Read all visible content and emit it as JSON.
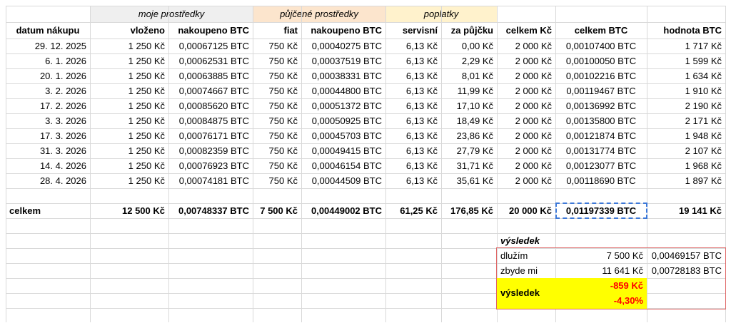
{
  "groups": {
    "own": "moje prostředky",
    "borrowed": "půjčené prostředky",
    "fees": "poplatky"
  },
  "colors": {
    "own_header_bg": "#efefef",
    "borrowed_header_bg": "#fce5cd",
    "fees_header_bg": "#fff2cc",
    "selection_border": "#3c78d8",
    "result_box_border": "#e06666",
    "result_highlight": "#ffff00",
    "negative_text": "#ff0000"
  },
  "columns": [
    "datum nákupu",
    "vloženo",
    "nakoupeno BTC",
    "fiat",
    "nakoupeno BTC",
    "servisní",
    "za půjčku",
    "celkem Kč",
    "celkem BTC",
    "hodnota BTC"
  ],
  "rows": [
    [
      "29. 12. 2025",
      "1 250 Kč",
      "0,00067125 BTC",
      "750 Kč",
      "0,00040275 BTC",
      "6,13 Kč",
      "0,00 Kč",
      "2 000 Kč",
      "0,00107400 BTC",
      "1 717 Kč"
    ],
    [
      "6. 1. 2026",
      "1 250 Kč",
      "0,00062531 BTC",
      "750 Kč",
      "0,00037519 BTC",
      "6,13 Kč",
      "2,29 Kč",
      "2 000 Kč",
      "0,00100050 BTC",
      "1 599 Kč"
    ],
    [
      "20. 1. 2026",
      "1 250 Kč",
      "0,00063885 BTC",
      "750 Kč",
      "0,00038331 BTC",
      "6,13 Kč",
      "8,01 Kč",
      "2 000 Kč",
      "0,00102216 BTC",
      "1 634 Kč"
    ],
    [
      "3. 2. 2026",
      "1 250 Kč",
      "0,00074667 BTC",
      "750 Kč",
      "0,00044800 BTC",
      "6,13 Kč",
      "11,99 Kč",
      "2 000 Kč",
      "0,00119467 BTC",
      "1 910 Kč"
    ],
    [
      "17. 2. 2026",
      "1 250 Kč",
      "0,00085620 BTC",
      "750 Kč",
      "0,00051372 BTC",
      "6,13 Kč",
      "17,10 Kč",
      "2 000 Kč",
      "0,00136992 BTC",
      "2 190 Kč"
    ],
    [
      "3. 3. 2026",
      "1 250 Kč",
      "0,00084875 BTC",
      "750 Kč",
      "0,00050925 BTC",
      "6,13 Kč",
      "18,49 Kč",
      "2 000 Kč",
      "0,00135800 BTC",
      "2 171 Kč"
    ],
    [
      "17. 3. 2026",
      "1 250 Kč",
      "0,00076171 BTC",
      "750 Kč",
      "0,00045703 BTC",
      "6,13 Kč",
      "23,86 Kč",
      "2 000 Kč",
      "0,00121874 BTC",
      "1 948 Kč"
    ],
    [
      "31. 3. 2026",
      "1 250 Kč",
      "0,00082359 BTC",
      "750 Kč",
      "0,00049415 BTC",
      "6,13 Kč",
      "27,79 Kč",
      "2 000 Kč",
      "0,00131774 BTC",
      "2 107 Kč"
    ],
    [
      "14. 4. 2026",
      "1 250 Kč",
      "0,00076923 BTC",
      "750 Kč",
      "0,00046154 BTC",
      "6,13 Kč",
      "31,71 Kč",
      "2 000 Kč",
      "0,00123077 BTC",
      "1 968 Kč"
    ],
    [
      "28. 4. 2026",
      "1 250 Kč",
      "0,00074181 BTC",
      "750 Kč",
      "0,00044509 BTC",
      "6,13 Kč",
      "35,61 Kč",
      "2 000 Kč",
      "0,00118690 BTC",
      "1 897 Kč"
    ]
  ],
  "total": [
    "celkem",
    "12 500 Kč",
    "0,00748337 BTC",
    "7 500 Kč",
    "0,00449002 BTC",
    "61,25 Kč",
    "176,85 Kč",
    "20 000 Kč",
    "0,01197339 BTC",
    "19 141 Kč"
  ],
  "result": {
    "title": "výsledek",
    "owe_label": "dlužím",
    "owe_czk": "7 500 Kč",
    "owe_btc": "0,00469157 BTC",
    "left_label": "zbyde mi",
    "left_czk": "11 641 Kč",
    "left_btc": "0,00728183 BTC",
    "result_label": "výsledek",
    "result_czk": "-859 Kč",
    "result_pct": "-4,30%"
  }
}
